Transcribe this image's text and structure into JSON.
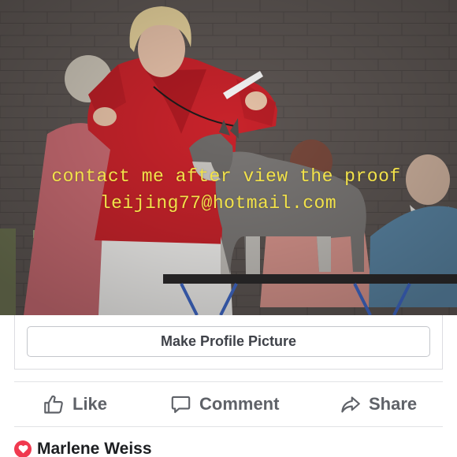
{
  "photo": {
    "watermark_line1": "contact me after view the proof",
    "watermark_line2": "leijing77@hotmail.com"
  },
  "profile": {
    "make_profile_label": "Make Profile Picture"
  },
  "actions": {
    "like_label": "Like",
    "comment_label": "Comment",
    "share_label": "Share"
  },
  "reaction": {
    "name": "Marlene Weiss",
    "icon": "heart-icon",
    "color": "#f0394f"
  },
  "colors": {
    "watermark": "#f2e24a",
    "jacket": "#c8232b",
    "action_text": "#5f6268",
    "button_text": "#3f4249"
  }
}
